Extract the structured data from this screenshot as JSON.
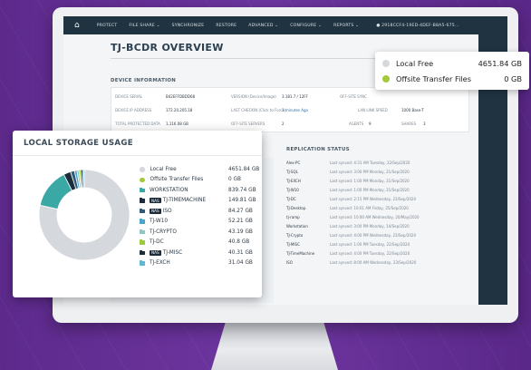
{
  "nav": {
    "items": [
      "PROTECT",
      "FILE SHARE ⌄",
      "SYNCHRONIZE",
      "RESTORE",
      "ADVANCED ⌄",
      "CONFIGURE ⌄",
      "REPORTS ⌄"
    ],
    "user": "2918CCF4-19ED-4DEF-B8A5-675..."
  },
  "page": {
    "title": "TJ-BCDR OVERVIEW",
    "device_info_heading": "DEVICE INFORMATION",
    "replication_heading": "REPLICATION STATUS"
  },
  "device_info": {
    "serial_label": "DEVICE SERIAL",
    "serial_value": "B42EFFDBDD68",
    "version_label": "VERSION (Device/Image)",
    "version_value": "3.181.7 / 12FF",
    "offsite_label": "OFF-SITE SYNC",
    "ip_label": "DEVICE IP ADDRESS",
    "ip_value": "172.20.205.18",
    "checkin_label": "LAST CHECKIN (Click to Force)",
    "checkin_value": "3 minutes Ago",
    "link_label": "LAN LINK SPEED",
    "link_value": "1000 Base-T",
    "protected_label": "TOTAL PROTECTED DATA",
    "protected_value": "1,116.08 GB",
    "servers_label": "OFF-SITE SERVERS",
    "servers_value": "2",
    "agents_label": "AGENTS",
    "agents_value": "9",
    "shares_label": "SHARES",
    "shares_value": "3"
  },
  "replication": [
    {
      "name": "Alex-PC",
      "time": "Last synced: 4:31 AM Tuesday, 22/Sep/2020"
    },
    {
      "name": "TJ-SQL",
      "time": "Last synced: 3:00 PM Monday, 21/Sep/2020"
    },
    {
      "name": "TJ-EXCH",
      "time": "Last synced: 1:00 PM Monday, 21/Sep/2020"
    },
    {
      "name": "TJ-W10",
      "time": "Last synced: 1:00 PM Monday, 21/Sep/2020"
    },
    {
      "name": "TJ-DC",
      "time": "Last synced: 2:15 PM Wednesday, 23/Sep/2020"
    },
    {
      "name": "TJ-Desktop",
      "time": "Last synced: 10:01 AM Friday, 25/Sep/2020"
    },
    {
      "name": "tj-ramp",
      "time": "Last synced: 10:00 AM Wednesday, 20/May/2020"
    },
    {
      "name": "Workstation",
      "time": "Last synced: 3:00 PM Monday, 14/Sep/2020"
    },
    {
      "name": "TJ-Crypto",
      "time": "Last synced: 4:00 PM Wednesday, 23/Sep/2020"
    },
    {
      "name": "TJ-MISC",
      "time": "Last synced: 1:00 PM Tuesday, 22/Sep/2020"
    },
    {
      "name": "TJ-TimeMachine",
      "time": "Last synced: 4:00 PM Tuesday, 22/Sep/2020"
    },
    {
      "name": "ISO",
      "time": "Last synced: 8:00 AM Wednesday, 23/Sep/2020"
    }
  ],
  "floating_legend": [
    {
      "label": "Local Free",
      "value": "4651.84 GB",
      "color": "#d5d8dc"
    },
    {
      "label": "Offsite Transfer Files",
      "value": "0 GB",
      "color": "#a4c93a"
    }
  ],
  "storage": {
    "heading": "LOCAL STORAGE USAGE",
    "items": [
      {
        "kind": "dot",
        "nas": false,
        "label": "Local Free",
        "value": "4651.84 GB",
        "color": "#d5d8dc",
        "gb": 4651.84
      },
      {
        "kind": "dot",
        "nas": false,
        "label": "Offsite Transfer Files",
        "value": "0 GB",
        "color": "#a4c93a",
        "gb": 0
      },
      {
        "kind": "folder",
        "nas": false,
        "label": "WORKSTATION",
        "value": "839.74 GB",
        "color": "#3aa8a4",
        "gb": 839.74
      },
      {
        "kind": "folder",
        "nas": true,
        "label": "TJ-TIMEMACHINE",
        "value": "149.81 GB",
        "color": "#1c2c3a",
        "gb": 149.81
      },
      {
        "kind": "folder",
        "nas": true,
        "label": "ISO",
        "value": "84.27 GB",
        "color": "#2f5b7a",
        "gb": 84.27
      },
      {
        "kind": "folder",
        "nas": false,
        "label": "TJ-W10",
        "value": "52.21 GB",
        "color": "#4aa3c9",
        "gb": 52.21
      },
      {
        "kind": "folder",
        "nas": false,
        "label": "TJ-CRYPTO",
        "value": "43.19 GB",
        "color": "#8fc6c0",
        "gb": 43.19
      },
      {
        "kind": "folder",
        "nas": false,
        "label": "TJ-DC",
        "value": "40.8 GB",
        "color": "#9ec93f",
        "gb": 40.8
      },
      {
        "kind": "folder",
        "nas": true,
        "label": "TJ-MISC",
        "value": "40.31 GB",
        "color": "#1c2c3a",
        "gb": 40.31
      },
      {
        "kind": "folder",
        "nas": false,
        "label": "TJ-EXCH",
        "value": "31.04 GB",
        "color": "#5fb7d4",
        "gb": 31.04
      }
    ]
  },
  "nas_tag": "NAS"
}
